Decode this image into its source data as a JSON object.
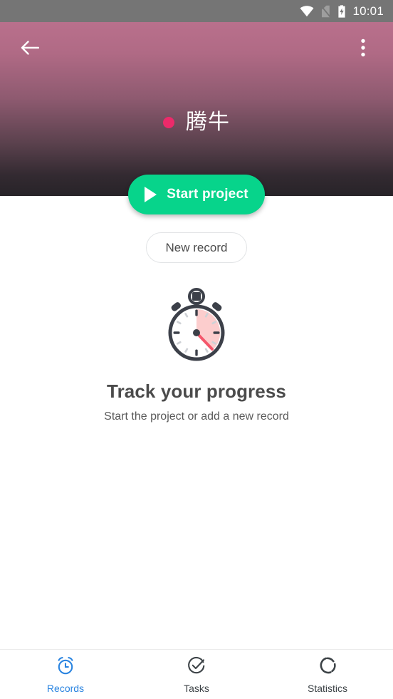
{
  "status_bar": {
    "time": "10:01",
    "icons": [
      "wifi-icon",
      "sim-off-icon",
      "battery-charging-icon"
    ],
    "background_color": "#757575"
  },
  "header": {
    "back_label": "back-arrow",
    "overflow_label": "more-options",
    "project_title": "腾牛",
    "dot_color": "#ec2a6a",
    "gradient_from": "#b9708c",
    "gradient_to": "#272328"
  },
  "actions": {
    "start_project_label": "Start project",
    "start_project_color": "#07d48b",
    "new_record_label": "New record"
  },
  "empty_state": {
    "illustration": "stopwatch-illustration",
    "title": "Track your progress",
    "subtitle": "Start the project or add a new record"
  },
  "bottom_nav": {
    "active_color": "#2a84e0",
    "inactive_color": "#3d4347",
    "items": [
      {
        "label": "Records",
        "icon": "alarm-clock-icon",
        "active": true
      },
      {
        "label": "Tasks",
        "icon": "check-circle-icon",
        "active": false
      },
      {
        "label": "Statistics",
        "icon": "donut-chart-icon",
        "active": false
      }
    ]
  }
}
